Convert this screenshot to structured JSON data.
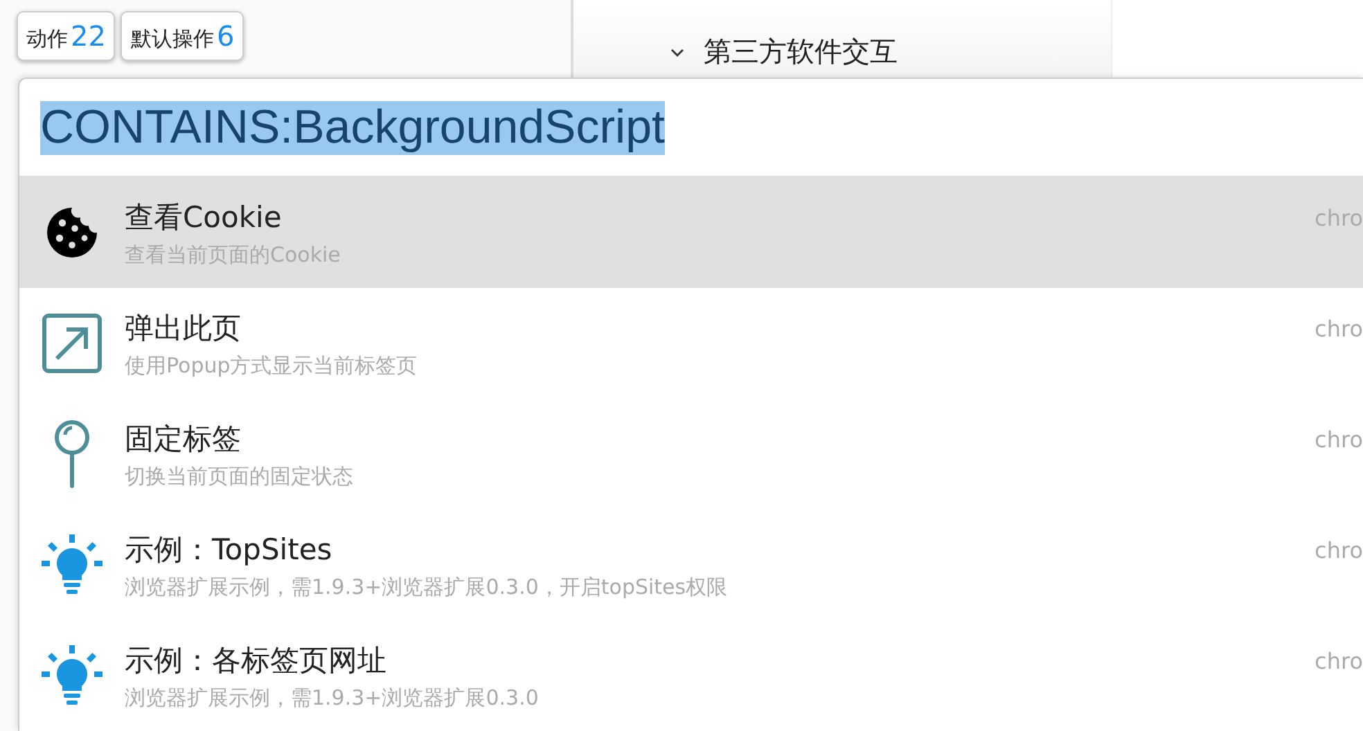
{
  "background": {
    "buttons": [
      {
        "label": "动作",
        "count": "22"
      },
      {
        "label": "默认操作",
        "count": "6"
      }
    ],
    "tree_item": {
      "label": "第三方软件交互",
      "expanded": true
    }
  },
  "launcher": {
    "query": "CONTAINS:BackgroundScript",
    "query_selected": true,
    "results": [
      {
        "kind": "cookie",
        "title": "查看Cookie",
        "subtitle": "查看当前页面的Cookie",
        "source": "chro",
        "selected": true
      },
      {
        "kind": "popout",
        "title": "弹出此页",
        "subtitle": "使用Popup方式显示当前标签页",
        "source": "chro",
        "selected": false
      },
      {
        "kind": "pin",
        "title": "固定标签",
        "subtitle": "切换当前页面的固定状态",
        "source": "chro",
        "selected": false
      },
      {
        "kind": "bulb",
        "title": "示例：TopSites",
        "subtitle": "浏览器扩展示例，需1.9.3+浏览器扩展0.3.0，开启topSites权限",
        "source": "chro",
        "selected": false
      },
      {
        "kind": "bulb",
        "title": "示例：各标签页网址",
        "subtitle": "浏览器扩展示例，需1.9.3+浏览器扩展0.3.0",
        "source": "chro",
        "selected": false
      }
    ]
  }
}
